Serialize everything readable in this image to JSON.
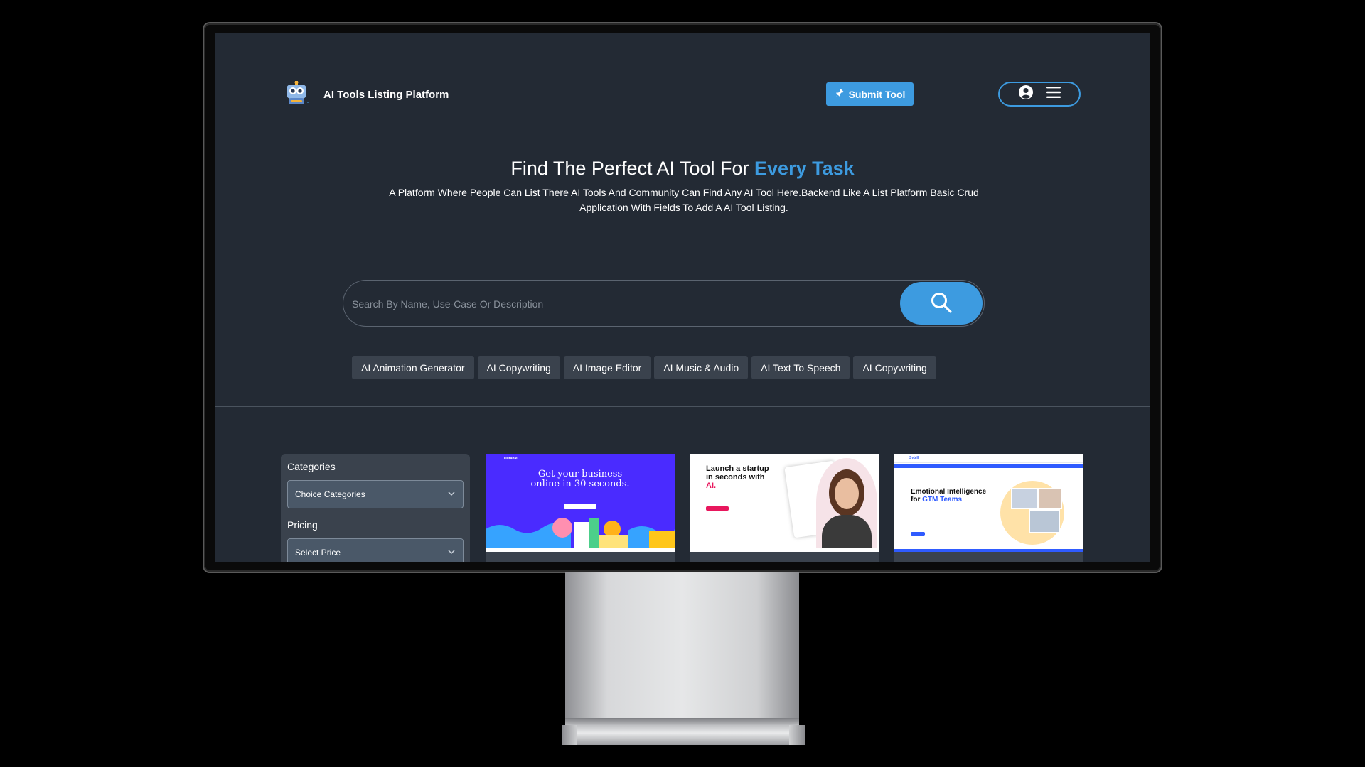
{
  "header": {
    "brand": "AI Tools Listing Platform",
    "submit_label": "Submit Tool"
  },
  "hero": {
    "title_main": "Find The Perfect AI Tool For ",
    "title_accent": "Every Task",
    "description": "A Platform Where People Can List There AI Tools And Community Can Find Any AI Tool Here.Backend Like A List Platform Basic Crud Application With Fields To Add A AI Tool Listing."
  },
  "search": {
    "placeholder": "Search By Name, Use-Case Or Description"
  },
  "tags": [
    "AI Animation Generator",
    "AI Copywriting",
    "AI Image Editor",
    "AI Music & Audio",
    "AI Text To Speech",
    "AI Copywriting"
  ],
  "filters": {
    "categories_label": "Categories",
    "categories_value": "Choice Categories",
    "pricing_label": "Pricing",
    "pricing_value": "Select Price"
  },
  "cards": [
    {
      "heading": "Get your business online in 30 seconds.",
      "brand": "Durable",
      "accent": "#4a2bff"
    },
    {
      "heading_line1": "Launch a startup",
      "heading_line2": "in seconds with",
      "heading_accent": "AI.",
      "accent": "#e8175d"
    },
    {
      "brand": "Sybill",
      "heading_line1": "Emotional Intelligence",
      "heading_prefix": "for ",
      "heading_accent": "GTM Teams",
      "accent": "#2f5bff"
    }
  ],
  "colors": {
    "accent": "#3d9be0",
    "background": "#232a34",
    "panel": "#3a424d"
  }
}
